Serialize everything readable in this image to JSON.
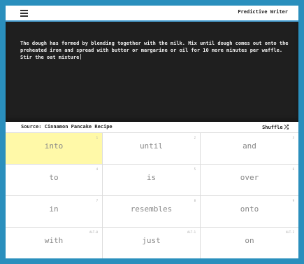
{
  "header": {
    "menu_icon": "hamburger-menu-icon",
    "title": "Predictive Writer"
  },
  "editor": {
    "text": "The dough has formed by blending together with the milk. Mix until dough comes out onto the preheated iron and spread with butter or margarine or oil for 10 more minutes per waffle. Stir the oat mixture"
  },
  "source": {
    "label": "Source: Cinnamon Pancake Recipe",
    "shuffle_label": "Shuffle",
    "shuffle_icon": "shuffle-icon"
  },
  "suggestions": [
    {
      "word": "into",
      "key": "1",
      "selected": true
    },
    {
      "word": "until",
      "key": "2",
      "selected": false
    },
    {
      "word": "and",
      "key": "3",
      "selected": false
    },
    {
      "word": "to",
      "key": "4",
      "selected": false
    },
    {
      "word": "is",
      "key": "5",
      "selected": false
    },
    {
      "word": "over",
      "key": "6",
      "selected": false
    },
    {
      "word": "in",
      "key": "7",
      "selected": false
    },
    {
      "word": "resembles",
      "key": "8",
      "selected": false
    },
    {
      "word": "onto",
      "key": "9",
      "selected": false
    },
    {
      "word": "with",
      "key": "ALT-0",
      "selected": false
    },
    {
      "word": "just",
      "key": "ALT-1",
      "selected": false
    },
    {
      "word": "on",
      "key": "ALT-2",
      "selected": false
    }
  ],
  "colors": {
    "frame": "#2a8fbd",
    "accent": "#4ba3d6",
    "editor_bg": "#1f1f1f",
    "selected_bg": "#fff9a8"
  }
}
